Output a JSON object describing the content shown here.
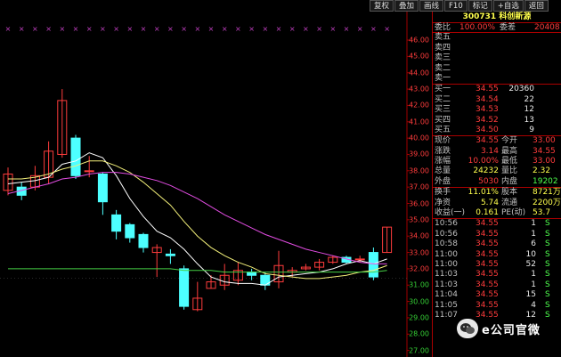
{
  "toolbar": [
    "复权",
    "叠加",
    "画线",
    "F10",
    "标记",
    "+自选",
    "返回"
  ],
  "stock": {
    "code": "300731",
    "name": "科创新源"
  },
  "ratio": {
    "label": "委比",
    "value": "100.00%",
    "diff_label": "委差",
    "diff_value": "20408"
  },
  "sell": [
    {
      "label": "卖五",
      "price": "",
      "vol": ""
    },
    {
      "label": "卖四",
      "price": "",
      "vol": ""
    },
    {
      "label": "卖三",
      "price": "",
      "vol": ""
    },
    {
      "label": "卖二",
      "price": "",
      "vol": ""
    },
    {
      "label": "卖一",
      "price": "",
      "vol": ""
    }
  ],
  "buy": [
    {
      "label": "买一",
      "price": "34.55",
      "vol": "20360"
    },
    {
      "label": "买二",
      "price": "34.54",
      "vol": "22"
    },
    {
      "label": "买三",
      "price": "34.53",
      "vol": "12"
    },
    {
      "label": "买四",
      "price": "34.52",
      "vol": "13"
    },
    {
      "label": "买五",
      "price": "34.50",
      "vol": "9"
    }
  ],
  "quote": [
    {
      "l1": "现价",
      "v1": "34.55",
      "l2": "今开",
      "v2": "33.00"
    },
    {
      "l1": "涨跌",
      "v1": "3.14",
      "l2": "最高",
      "v2": "34.55"
    },
    {
      "l1": "涨幅",
      "v1": "10.00%",
      "l2": "最低",
      "v2": "33.00"
    },
    {
      "l1": "总量",
      "v1": "24232",
      "l2": "量比",
      "v2": "2.32"
    },
    {
      "l1": "外盘",
      "v1": "5030",
      "l2": "内盘",
      "v2": "19202"
    }
  ],
  "stats": [
    {
      "l1": "换手",
      "v1": "11.01%",
      "l2": "股本",
      "v2": "8721万"
    },
    {
      "l1": "净资",
      "v1": "5.74",
      "l2": "流通",
      "v2": "2200万"
    },
    {
      "l1": "收益(一)",
      "v1": "0.161",
      "l2": "PE(动)",
      "v2": "53.7"
    }
  ],
  "ticks": [
    {
      "time": "10:56",
      "price": "34.55",
      "vol": "1",
      "flag": "S"
    },
    {
      "time": "10:56",
      "price": "34.55",
      "vol": "1",
      "flag": "S"
    },
    {
      "time": "10:58",
      "price": "34.55",
      "vol": "6",
      "flag": "S"
    },
    {
      "time": "11:00",
      "price": "34.55",
      "vol": "10",
      "flag": "S"
    },
    {
      "time": "11:00",
      "price": "34.55",
      "vol": "52",
      "flag": "S"
    },
    {
      "time": "11:03",
      "price": "34.55",
      "vol": "1",
      "flag": "S"
    },
    {
      "time": "11:03",
      "price": "34.55",
      "vol": "1",
      "flag": "S"
    },
    {
      "time": "11:04",
      "price": "34.55",
      "vol": "15",
      "flag": "S"
    },
    {
      "time": "11:05",
      "price": "34.55",
      "vol": "4",
      "flag": "S"
    },
    {
      "time": "11:07",
      "price": "34.55",
      "vol": "12",
      "flag": "S"
    }
  ],
  "axis": {
    "ticks": [
      "46.00",
      "45.00",
      "44.00",
      "43.00",
      "42.00",
      "41.00",
      "40.00",
      "39.00",
      "38.00",
      "37.00",
      "36.00",
      "35.00",
      "34.00",
      "33.00",
      "32.00",
      "31.00",
      "30.00",
      "29.00",
      "28.00",
      "27.00"
    ],
    "ref_price": "31.41"
  },
  "chart_data": {
    "type": "candlestick",
    "y_range": [
      26.6,
      47.2
    ],
    "candles": [
      {
        "o": 36.8,
        "c": 37.8,
        "h": 38.2,
        "l": 36.5
      },
      {
        "o": 37.0,
        "c": 36.5,
        "h": 37.3,
        "l": 36.2
      },
      {
        "o": 37.0,
        "c": 37.7,
        "h": 38.3,
        "l": 36.8
      },
      {
        "o": 37.6,
        "c": 39.2,
        "h": 39.8,
        "l": 37.2
      },
      {
        "o": 39.0,
        "c": 42.3,
        "h": 43.0,
        "l": 38.8
      },
      {
        "o": 40.0,
        "c": 37.7,
        "h": 40.2,
        "l": 37.5
      },
      {
        "o": 38.0,
        "c": 38.0,
        "h": 38.9,
        "l": 37.6
      },
      {
        "o": 37.8,
        "c": 36.1,
        "h": 37.9,
        "l": 35.3
      },
      {
        "o": 35.3,
        "c": 34.3,
        "h": 35.6,
        "l": 33.8
      },
      {
        "o": 34.7,
        "c": 33.9,
        "h": 34.8,
        "l": 33.6
      },
      {
        "o": 34.1,
        "c": 33.3,
        "h": 34.2,
        "l": 33.0
      },
      {
        "o": 33.0,
        "c": 33.3,
        "h": 33.5,
        "l": 31.5
      },
      {
        "o": 32.9,
        "c": 32.8,
        "h": 33.2,
        "l": 32.3
      },
      {
        "o": 32.0,
        "c": 29.7,
        "h": 32.2,
        "l": 29.5
      },
      {
        "o": 29.5,
        "c": 30.2,
        "h": 31.2,
        "l": 29.4
      },
      {
        "o": 30.8,
        "c": 31.2,
        "h": 31.6,
        "l": 30.8
      },
      {
        "o": 31.0,
        "c": 31.6,
        "h": 32.3,
        "l": 30.7
      },
      {
        "o": 31.3,
        "c": 31.9,
        "h": 32.4,
        "l": 31.0
      },
      {
        "o": 31.8,
        "c": 31.6,
        "h": 32.0,
        "l": 31.3
      },
      {
        "o": 31.6,
        "c": 31.0,
        "h": 31.8,
        "l": 30.7
      },
      {
        "o": 31.2,
        "c": 32.2,
        "h": 33.1,
        "l": 30.8
      },
      {
        "o": 31.8,
        "c": 31.9,
        "h": 32.1,
        "l": 31.5
      },
      {
        "o": 32.0,
        "c": 32.1,
        "h": 32.3,
        "l": 31.9
      },
      {
        "o": 32.1,
        "c": 32.4,
        "h": 32.6,
        "l": 31.9
      },
      {
        "o": 32.4,
        "c": 32.7,
        "h": 32.8,
        "l": 32.3
      },
      {
        "o": 32.7,
        "c": 32.4,
        "h": 32.8,
        "l": 32.3
      },
      {
        "o": 32.6,
        "c": 32.6,
        "h": 32.8,
        "l": 32.4
      },
      {
        "o": 33.0,
        "c": 31.5,
        "h": 33.3,
        "l": 31.3
      },
      {
        "o": 33.0,
        "c": 34.55,
        "h": 34.55,
        "l": 33.0
      }
    ],
    "ma_series": [
      {
        "name": "MA5",
        "color": "#ffffff",
        "values": [
          37.2,
          37.3,
          37.4,
          37.6,
          38.4,
          38.6,
          39.1,
          38.8,
          37.7,
          36.3,
          35.2,
          34.3,
          33.9,
          33.2,
          32.3,
          31.5,
          31.2,
          31.1,
          31.1,
          31.0,
          31.5,
          31.6,
          31.7,
          31.8,
          32.0,
          32.3,
          32.5,
          32.3,
          32.6
        ]
      },
      {
        "name": "MA10",
        "color": "#f3f07a",
        "values": [
          37.5,
          37.5,
          37.6,
          37.8,
          38.1,
          38.3,
          38.6,
          38.6,
          38.3,
          37.9,
          37.3,
          36.6,
          35.9,
          34.9,
          34.0,
          33.3,
          32.8,
          32.4,
          32.1,
          31.7,
          31.6,
          31.5,
          31.4,
          31.4,
          31.5,
          31.6,
          31.8,
          31.9,
          32.2
        ]
      },
      {
        "name": "MA20",
        "color": "#e14ce1",
        "values": [
          36.6,
          36.8,
          37.0,
          37.2,
          37.5,
          37.6,
          37.8,
          37.9,
          37.9,
          37.8,
          37.6,
          37.4,
          37.1,
          36.7,
          36.3,
          35.8,
          35.3,
          34.9,
          34.5,
          34.1,
          33.8,
          33.5,
          33.2,
          33.0,
          32.8,
          32.6,
          32.4,
          32.3,
          32.3
        ]
      },
      {
        "name": "MA60",
        "color": "#45d045",
        "values": [
          32.0,
          32.0,
          32.0,
          32.0,
          32.0,
          32.0,
          32.0,
          32.0,
          32.0,
          32.0,
          32.0,
          32.0,
          32.0,
          31.9,
          31.9,
          31.9,
          31.8,
          31.8,
          31.8,
          31.8,
          31.8,
          31.8,
          31.8,
          31.8,
          31.8,
          31.8,
          31.8,
          31.8,
          31.9
        ]
      }
    ]
  },
  "watermark": "e公司官微",
  "colors": {
    "up": "#ff3c3c",
    "down": "#4dffff",
    "grid": "#a00000"
  }
}
